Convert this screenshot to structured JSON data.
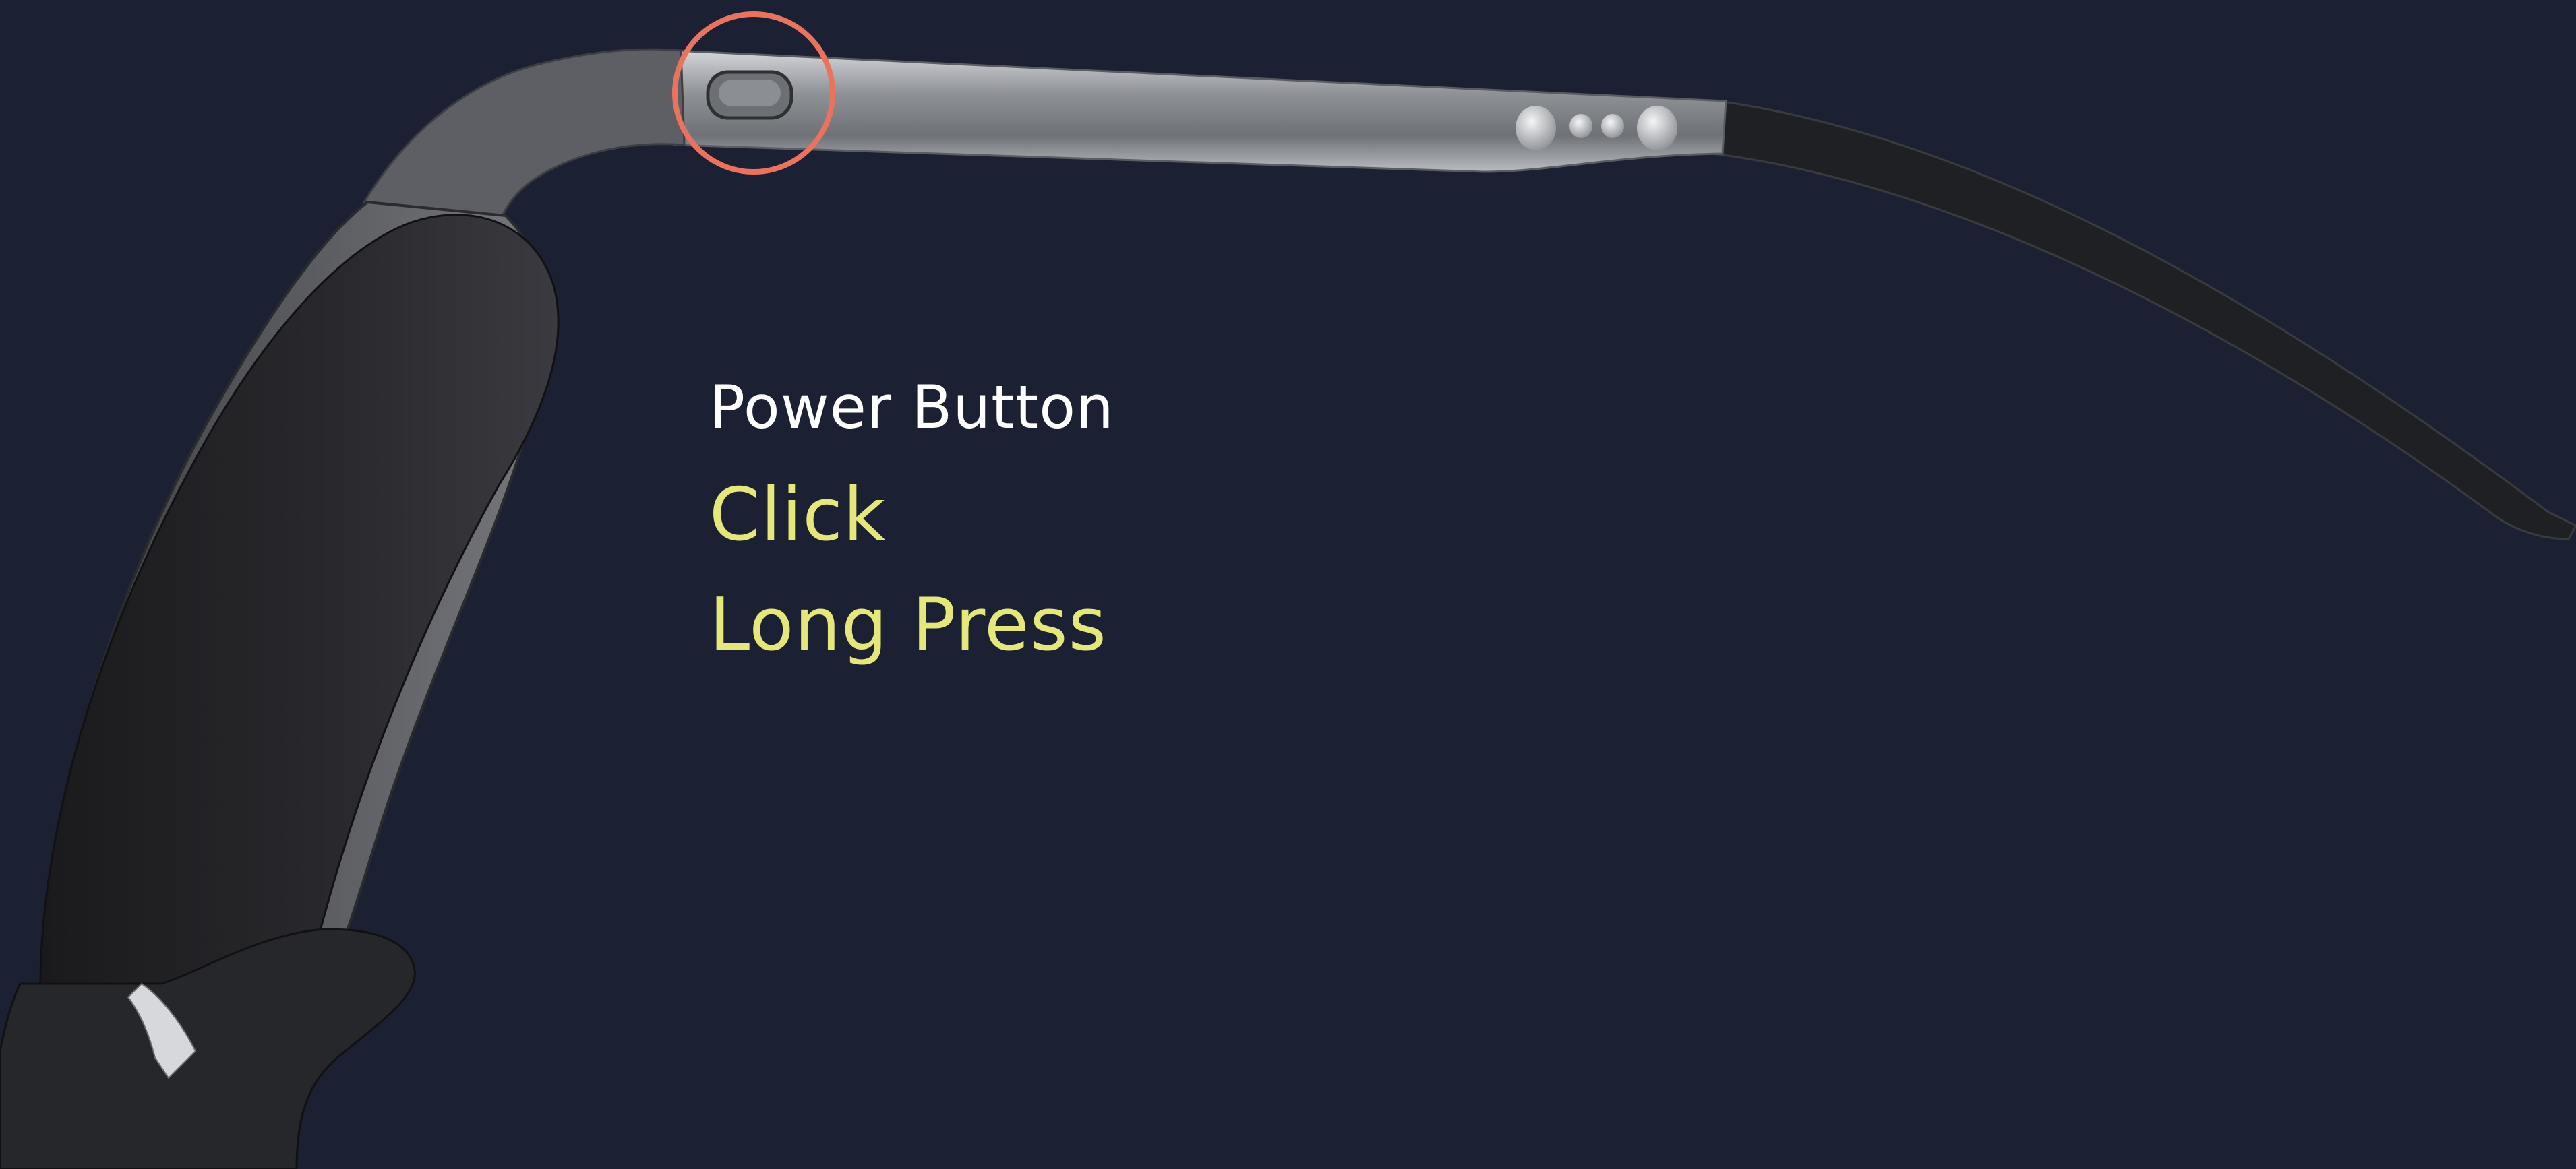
{
  "callout": {
    "title": "Power Button",
    "gestures": [
      {
        "label": "Click"
      },
      {
        "label": "Long Press"
      }
    ]
  },
  "colors": {
    "background": "#1c2033",
    "title_text": "#ffffff",
    "gesture_text": "#e6e77a",
    "highlight_ring": "#e8735f",
    "frame_metal": "#8a8d92",
    "frame_dark": "#202124"
  }
}
